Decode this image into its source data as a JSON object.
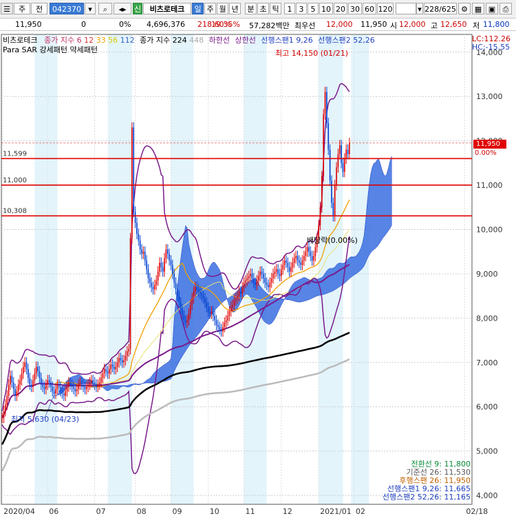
{
  "toolbar": {
    "market": "주",
    "side": "전",
    "code": "042370",
    "name": "비츠로테크",
    "badge": "신",
    "periods": [
      "일",
      "주",
      "월",
      "년",
      "분",
      "초",
      "틱"
    ],
    "intervals": [
      "1",
      "3",
      "5",
      "10",
      "20",
      "30",
      "60",
      "120"
    ],
    "page": "228/625"
  },
  "info": {
    "price": "11,950",
    "change": "0",
    "change_pct": "0%",
    "volume": "4,696,376",
    "turnover_pct": "218.60%",
    "ratio": "19.35%",
    "amount": "57,282백만",
    "pref_label": "최우선",
    "pref_price": "12,000",
    "current": "11,950",
    "open_label": "시",
    "open": "12,000",
    "high_label": "고",
    "high": "12,650",
    "low_label": "저",
    "low": "11,800"
  },
  "legend": {
    "name": "비츠로테크",
    "ma_label": "종가 지수",
    "ma": [
      "6",
      "12",
      "33",
      "56",
      "112"
    ],
    "ma_label2": "종가 지수",
    "ma2": [
      "224",
      "448"
    ],
    "band_low": "하한선",
    "band_high": "상한선",
    "span1": "선행스팬1 9,26",
    "span2": "선행스팬2 52,26",
    "line2": "Para SAR 강세패턴  약세패턴",
    "lc": "LC:112.26",
    "hc": "HC:-15.55"
  },
  "annotations": {
    "high": "최고 14,150 (01/21)",
    "low": "최저 5,630 (04/23)",
    "dividend": "배당락(0.00%)",
    "price_tag": "11,950",
    "pct_tag": "0.00%"
  },
  "hlines": [
    {
      "label": "11,599",
      "value": 11599
    },
    {
      "label": "11,000",
      "value": 11000
    },
    {
      "label": "10,308",
      "value": 10308
    }
  ],
  "ichimoku_readout": [
    {
      "text": "전환선 9: 11,800",
      "color": "#0a8a3a"
    },
    {
      "text": "기준선 26: 11,530",
      "color": "#555555"
    },
    {
      "text": "후행스팬 26: 11,950",
      "color": "#c06000"
    },
    {
      "text": "선행스팬1 9,26: 11,665",
      "color": "#2040c0"
    },
    {
      "text": "선행스팬2 52,26: 11,165",
      "color": "#2040c0"
    }
  ],
  "chart_data": {
    "type": "candlestick",
    "ylim": [
      3800,
      14400
    ],
    "y_ticks": [
      4000,
      5000,
      6000,
      7000,
      8000,
      9000,
      10000,
      11000,
      12000,
      13000,
      14000
    ],
    "y_tick_labels": [
      "4,000",
      "5,000",
      "6,000",
      "7,000",
      "8,000",
      "9,000",
      "10,000",
      "11,000",
      "12,000",
      "13,000",
      "14,000"
    ],
    "x_ticks": [
      {
        "label": "2020/04",
        "i": 0
      },
      {
        "label": "06",
        "i": 28
      },
      {
        "label": "07",
        "i": 57
      },
      {
        "label": "08",
        "i": 82
      },
      {
        "label": "09",
        "i": 104
      },
      {
        "label": "10",
        "i": 127
      },
      {
        "label": "11",
        "i": 149
      },
      {
        "label": "12",
        "i": 172
      },
      {
        "label": "2021/01",
        "i": 195
      },
      {
        "label": "02",
        "i": 217
      },
      {
        "label": "02/18",
        "i": 285
      }
    ],
    "closes": [
      5750,
      5900,
      6050,
      6250,
      6500,
      6700,
      6550,
      6400,
      6250,
      6350,
      6500,
      6600,
      6750,
      6900,
      7000,
      6850,
      6650,
      6500,
      6450,
      6600,
      6750,
      6900,
      6800,
      6650,
      6500,
      6450,
      6400,
      6500,
      6600,
      6550,
      6450,
      6350,
      6300,
      6400,
      6500,
      6450,
      6350,
      6300,
      6250,
      6350,
      6450,
      6550,
      6500,
      6450,
      6400,
      6350,
      6400,
      6500,
      6550,
      6500,
      6450,
      6400,
      6450,
      6500,
      6550,
      6600,
      6550,
      6500,
      6450,
      6500,
      6550,
      6650,
      6750,
      6850,
      6800,
      6750,
      6850,
      6950,
      6900,
      6850,
      6900,
      7000,
      7100,
      7050,
      7000,
      7050,
      7150,
      7250,
      7300,
      9800,
      12300,
      10400,
      10150,
      9900,
      9750,
      9550,
      9450,
      9500,
      9300,
      9100,
      8900,
      8800,
      8700,
      8650,
      8750,
      8850,
      9050,
      9250,
      9150,
      9050,
      9350,
      9550,
      9450,
      9300,
      9200,
      9000,
      8800,
      8650,
      8500,
      8350,
      8200,
      8050,
      7950,
      7900,
      7950,
      8100,
      8300,
      8450,
      8600,
      8700,
      8650,
      8600,
      8550,
      8500,
      8450,
      8350,
      8250,
      8150,
      8100,
      8150,
      8050,
      7950,
      7850,
      7800,
      7750,
      7700,
      7800,
      7900,
      7950,
      8050,
      8150,
      8250,
      8300,
      8400,
      8450,
      8500,
      8600,
      8550,
      8700,
      8800,
      8850,
      8900,
      8950,
      9000,
      8900,
      8800,
      8750,
      8850,
      8950,
      9050,
      9000,
      8900,
      8800,
      8750,
      8700,
      8800,
      8900,
      9000,
      9050,
      9100,
      9000,
      8950,
      9100,
      9200,
      9300,
      9250,
      9150,
      9050,
      9150,
      9250,
      9350,
      9400,
      9300,
      9250,
      9200,
      9300,
      9400,
      9500,
      9600,
      9500,
      9400,
      9300,
      9400,
      9600,
      9800,
      10100,
      10500,
      11200,
      12600,
      13100,
      12400,
      11800,
      11100,
      10600,
      10300,
      11000,
      11400,
      11700,
      11900,
      11500,
      11300,
      11600,
      11800,
      11700,
      11950
    ]
  }
}
